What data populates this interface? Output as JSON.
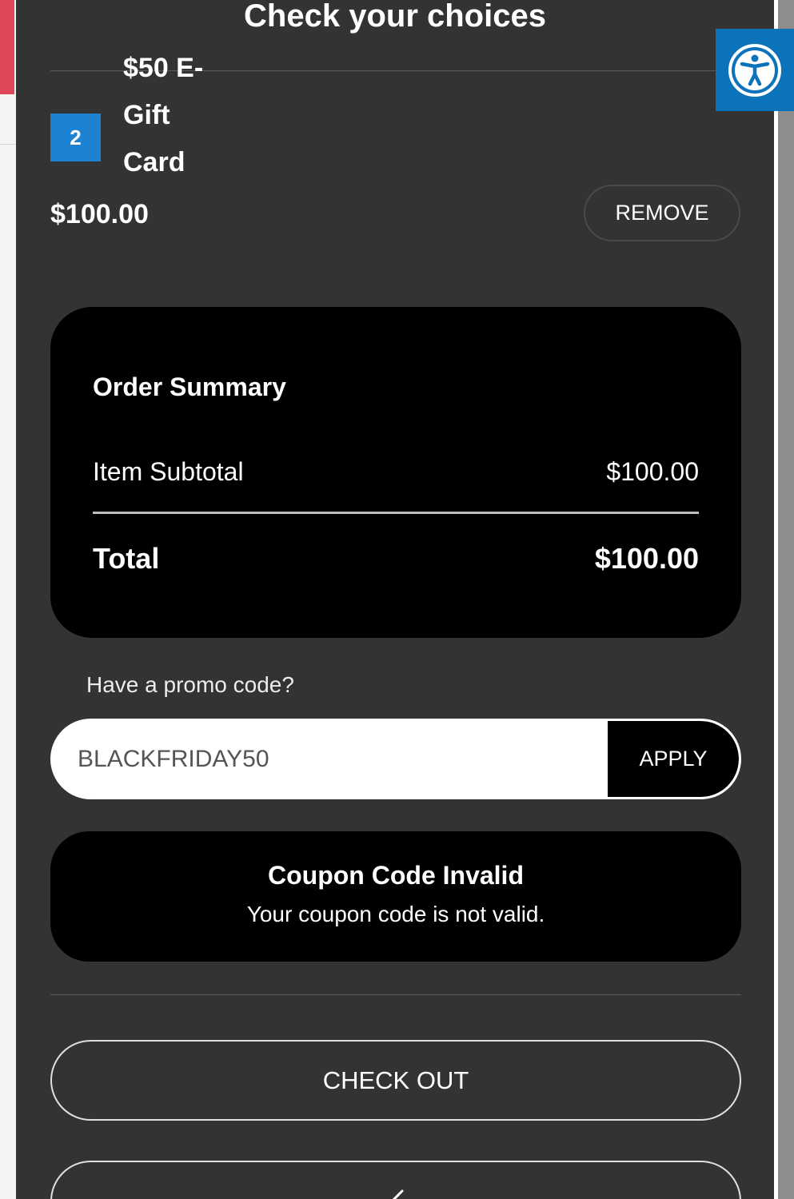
{
  "panel": {
    "title": "Check your choices"
  },
  "cart_item": {
    "quantity": "2",
    "name": "$50 E-Gift Card",
    "price": "$100.00",
    "remove_label": "REMOVE"
  },
  "order_summary": {
    "title": "Order Summary",
    "subtotal_label": "Item Subtotal",
    "subtotal_value": "$100.00",
    "total_label": "Total",
    "total_value": "$100.00"
  },
  "promo": {
    "label": "Have a promo code?",
    "value": "BLACKFRIDAY50",
    "apply_label": "APPLY"
  },
  "alert": {
    "title": "Coupon Code Invalid",
    "message": "Your coupon code is not valid."
  },
  "actions": {
    "checkout_label": "CHECK OUT",
    "continue_icon": "chevron-left-icon"
  },
  "accessibility": {
    "icon": "accessibility-icon"
  },
  "colors": {
    "panel_bg": "#333333",
    "card_bg": "#000000",
    "badge": "#1e82d2",
    "accessibility": "#0c73ba",
    "page_accent": "#e0485a"
  }
}
